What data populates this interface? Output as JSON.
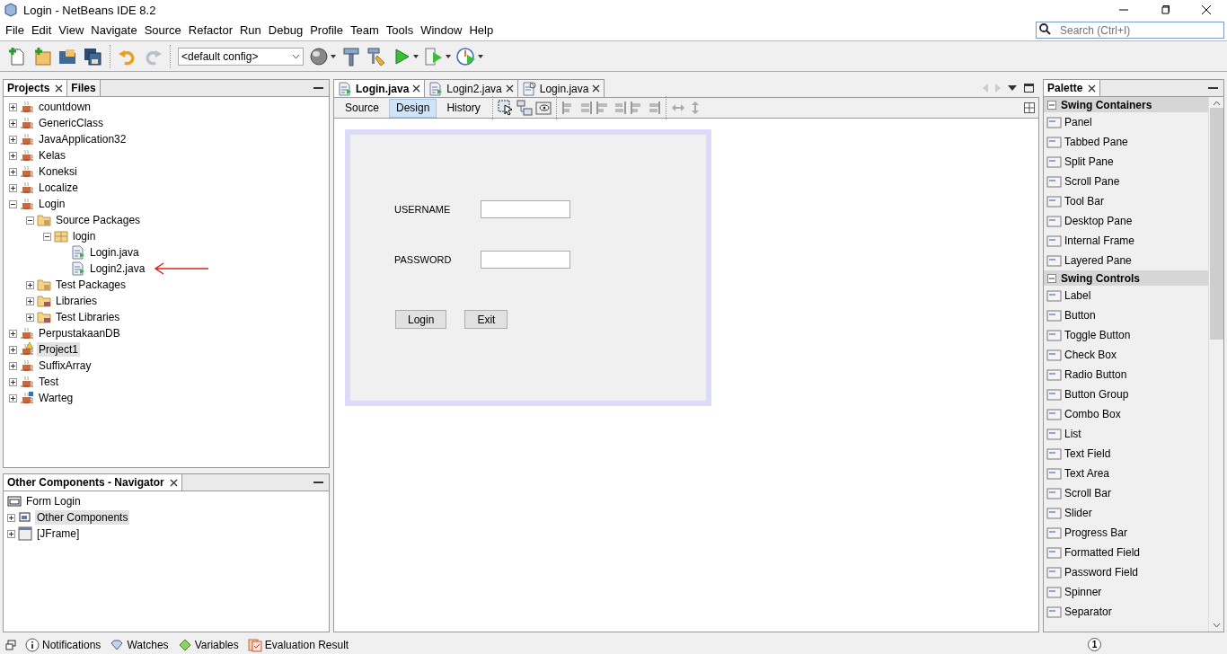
{
  "window": {
    "title": "Login - NetBeans IDE 8.2"
  },
  "menu": [
    "File",
    "Edit",
    "View",
    "Navigate",
    "Source",
    "Refactor",
    "Run",
    "Debug",
    "Profile",
    "Team",
    "Tools",
    "Window",
    "Help"
  ],
  "search": {
    "placeholder": "Search (Ctrl+I)"
  },
  "toolbar": {
    "config": "<default config>"
  },
  "projects": {
    "tabs": [
      {
        "label": "Projects",
        "selected": true
      },
      {
        "label": "Files",
        "selected": false
      }
    ],
    "tree": [
      {
        "label": "countdown",
        "kind": "project",
        "expanded": false,
        "selected": false
      },
      {
        "label": "GenericClass",
        "kind": "project",
        "expanded": false,
        "selected": false
      },
      {
        "label": "JavaApplication32",
        "kind": "project",
        "expanded": false,
        "selected": false
      },
      {
        "label": "Kelas",
        "kind": "project",
        "expanded": false,
        "selected": false
      },
      {
        "label": "Koneksi",
        "kind": "project",
        "expanded": false,
        "selected": false
      },
      {
        "label": "Localize",
        "kind": "project",
        "expanded": false,
        "selected": false
      },
      {
        "label": "Login",
        "kind": "project",
        "expanded": true,
        "selected": false,
        "children": [
          {
            "label": "Source Packages",
            "kind": "folder",
            "expanded": true,
            "selected": false,
            "children": [
              {
                "label": "login",
                "kind": "package",
                "expanded": true,
                "selected": false,
                "children": [
                  {
                    "label": "Login.java",
                    "kind": "file",
                    "selected": false
                  },
                  {
                    "label": "Login2.java",
                    "kind": "file",
                    "selected": false,
                    "annotated": true
                  }
                ]
              }
            ]
          },
          {
            "label": "Test Packages",
            "kind": "folder",
            "expanded": false,
            "selected": false
          },
          {
            "label": "Libraries",
            "kind": "library",
            "expanded": false,
            "selected": false
          },
          {
            "label": "Test Libraries",
            "kind": "library",
            "expanded": false,
            "selected": false
          }
        ]
      },
      {
        "label": "PerpustakaanDB",
        "kind": "project",
        "expanded": false,
        "selected": false
      },
      {
        "label": "Project1",
        "kind": "project-warning",
        "expanded": false,
        "selected": true
      },
      {
        "label": "SuffixArray",
        "kind": "project",
        "expanded": false,
        "selected": false
      },
      {
        "label": "Test",
        "kind": "project",
        "expanded": false,
        "selected": false
      },
      {
        "label": "Warteg",
        "kind": "project-lock",
        "expanded": false,
        "selected": false
      }
    ]
  },
  "navigator": {
    "title": "Other Components - Navigator",
    "root": "Form Login",
    "tree": [
      {
        "label": "Other Components",
        "kind": "components",
        "expanded": false,
        "selected": true
      },
      {
        "label": "[JFrame]",
        "kind": "frame",
        "expanded": false,
        "selected": false
      }
    ]
  },
  "editor": {
    "tabs": [
      {
        "label": "Login.java",
        "kind": "form",
        "selected": true
      },
      {
        "label": "Login2.java",
        "kind": "form",
        "selected": false
      },
      {
        "label": "Login.java",
        "kind": "source",
        "selected": false
      }
    ],
    "views": [
      {
        "label": "Source",
        "selected": false
      },
      {
        "label": "Design",
        "selected": true
      },
      {
        "label": "History",
        "selected": false
      }
    ],
    "form": {
      "fields": [
        {
          "label": "USERNAME"
        },
        {
          "label": "PASSWORD"
        }
      ],
      "buttons": [
        "Login",
        "Exit"
      ]
    }
  },
  "palette": {
    "title": "Palette",
    "categories": [
      {
        "title": "Swing Containers",
        "expanded": true,
        "items": [
          "Panel",
          "Tabbed Pane",
          "Split Pane",
          "Scroll Pane",
          "Tool Bar",
          "Desktop Pane",
          "Internal Frame",
          "Layered Pane"
        ]
      },
      {
        "title": "Swing Controls",
        "expanded": true,
        "items": [
          "Label",
          "Button",
          "Toggle Button",
          "Check Box",
          "Radio Button",
          "Button Group",
          "Combo Box",
          "List",
          "Text Field",
          "Text Area",
          "Scroll Bar",
          "Slider",
          "Progress Bar",
          "Formatted Field",
          "Password Field",
          "Spinner",
          "Separator"
        ]
      }
    ]
  },
  "status_bar": {
    "items": [
      {
        "label": "Notifications",
        "kind": "info"
      },
      {
        "label": "Watches",
        "kind": "watch"
      },
      {
        "label": "Variables",
        "kind": "variable"
      },
      {
        "label": "Evaluation Result",
        "kind": "result"
      }
    ],
    "badge": "1"
  }
}
